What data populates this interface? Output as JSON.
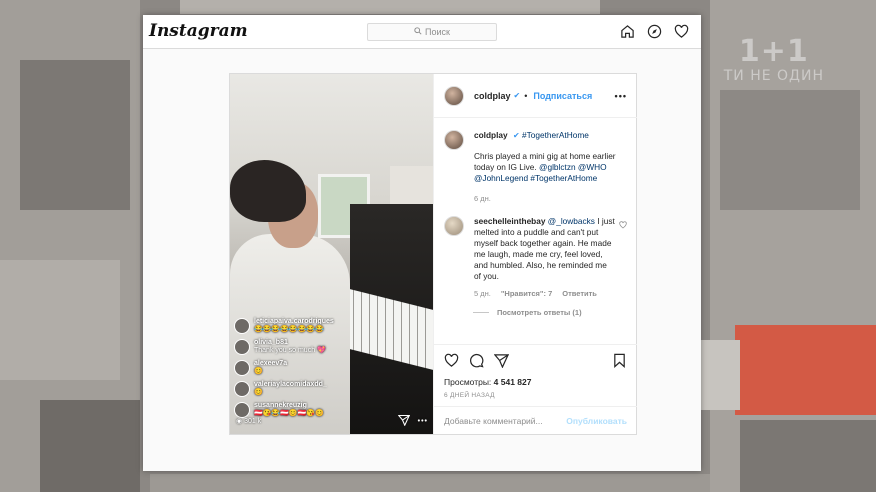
{
  "tv": {
    "logo_main": "1+1",
    "logo_sub": "ТИ НЕ ОДИН"
  },
  "instagram": {
    "logo": "Instagram",
    "search_placeholder": "Поиск"
  },
  "post": {
    "header": {
      "username": "coldplay",
      "follow": "Подписаться"
    },
    "caption": {
      "username": "coldplay",
      "hashtag": "#TogetherAtHome",
      "text": "Chris played a mini gig at home earlier today on IG Live.",
      "mention1": "@glblctzn",
      "mention2": "@WHO",
      "mention3": "@JohnLegend",
      "hashtag2": "#TogetherAtHome",
      "time": "6 дн."
    },
    "comment": {
      "username": "seechelleinthebay",
      "mention": "@_lowbacks",
      "text": "I just melted into a puddle and can't put myself back together again. He made me laugh, made me cry, feel loved, and humbled. Also, he reminded me of you.",
      "time": "5 дн.",
      "likes": "\"Нравится\": 7",
      "reply": "Ответить",
      "view_replies": "Посмотреть ответы (1)"
    },
    "views_label": "Просмотры:",
    "views_count": "4 541 827",
    "ago": "6 ДНЕЙ НАЗАД",
    "comment_placeholder": "Добавьте комментарий...",
    "publish": "Опубликовать"
  },
  "live": {
    "comments": [
      {
        "user": "leticiapaiva.carodrigues",
        "text": "😂😂😂😂😂😂😂😂"
      },
      {
        "user": "olivia_b81",
        "text": "Thank you so much 💖"
      },
      {
        "user": "alexeev7a",
        "text": "😊"
      },
      {
        "user": "valeriaylacomidaxdd_",
        "text": "😊"
      },
      {
        "user": "susannekreuzig",
        "text": "🇦🇹😘😂🇦🇹😊🇦🇹😘😊"
      }
    ],
    "viewers": "301 k"
  },
  "colors": {
    "accent": "#3897f0",
    "tag": "#003569",
    "muted": "#8e8e8e"
  }
}
